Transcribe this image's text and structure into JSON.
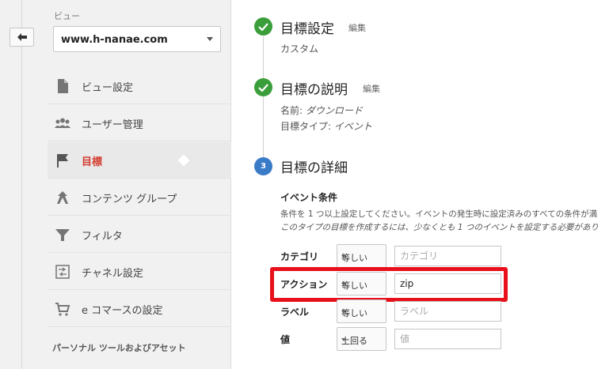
{
  "view": {
    "label": "ビュー",
    "selected": "www.h-nanae.com"
  },
  "sidebar": {
    "items": [
      {
        "label": "ビュー設定",
        "icon": "document-icon"
      },
      {
        "label": "ユーザー管理",
        "icon": "users-icon"
      },
      {
        "label": "目標",
        "icon": "flag-icon",
        "active": true
      },
      {
        "label": "コンテンツ グループ",
        "icon": "content-group-icon"
      },
      {
        "label": "フィルタ",
        "icon": "filter-icon"
      },
      {
        "label": "チャネル設定",
        "icon": "channel-icon"
      },
      {
        "label": "e コマースの設定",
        "icon": "cart-icon"
      }
    ],
    "section_heading": "パーソナル ツールおよびアセット"
  },
  "steps": [
    {
      "title": "目標設定",
      "edit": "編集",
      "lines": [
        {
          "text": "カスタム"
        }
      ]
    },
    {
      "title": "目標の説明",
      "edit": "編集",
      "lines": [
        {
          "prefix": "名前: ",
          "value": "ダウンロード"
        },
        {
          "prefix": "目標タイプ: ",
          "value": "イベント"
        }
      ]
    },
    {
      "title": "目標の詳細",
      "number": "3"
    }
  ],
  "event_conditions": {
    "title": "イベント条件",
    "desc1": "条件を 1 つ以上設定してください。イベントの発生時に設定済みのすべての条件が満",
    "desc2": "このタイプの目標を作成するには、少なくとも 1 つのイベントを設定する必要があり",
    "rows": [
      {
        "label": "カテゴリ",
        "operator": "等しい",
        "value": "",
        "placeholder": "カテゴリ"
      },
      {
        "label": "アクション",
        "operator": "等しい",
        "value": "zip",
        "placeholder": ""
      },
      {
        "label": "ラベル",
        "operator": "等しい",
        "value": "",
        "placeholder": "ラベル"
      },
      {
        "label": "値",
        "operator": "上回る",
        "value": "",
        "placeholder": "値"
      }
    ]
  },
  "colors": {
    "active_nav": "#d23f31",
    "done_step": "#3a9e3a",
    "current_step": "#3a7bc8",
    "highlight": "#e8111b"
  }
}
